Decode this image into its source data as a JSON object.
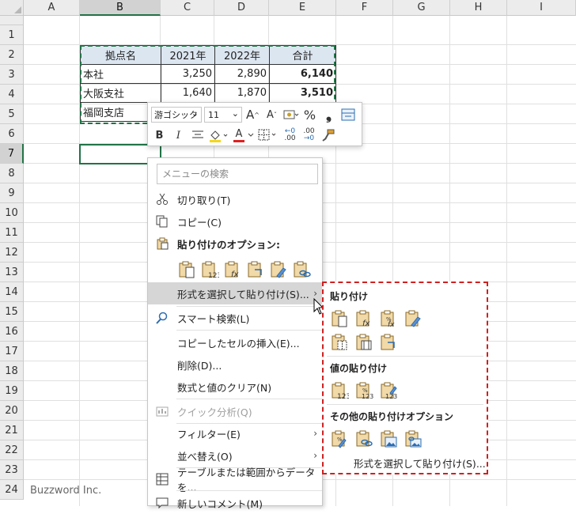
{
  "columns": [
    "A",
    "B",
    "C",
    "D",
    "E",
    "F",
    "G",
    "H",
    "I"
  ],
  "rows": [
    "1",
    "2",
    "3",
    "4",
    "5",
    "6",
    "7",
    "8",
    "9",
    "10",
    "11",
    "12",
    "13",
    "14",
    "15",
    "16",
    "17",
    "18",
    "19",
    "20",
    "21",
    "22",
    "23",
    "24"
  ],
  "table": {
    "headers": [
      "拠点名",
      "2021年",
      "2022年",
      "合計"
    ],
    "rows": [
      [
        "本社",
        "3,250",
        "2,890",
        "6,140"
      ],
      [
        "大阪支社",
        "1,640",
        "1,870",
        "3,510"
      ],
      [
        "福岡支店",
        "",
        "",
        ""
      ]
    ]
  },
  "mini_toolbar": {
    "font_name": "游ゴシック",
    "font_size": "11",
    "grow_label": "A",
    "shrink_label": "A",
    "percent_label": "%",
    "comma_label": "❟",
    "bold_label": "B",
    "italic_label": "I",
    "font_color_label": "A",
    "dec_inc_label": ".00",
    "dec_dec_label": ".00"
  },
  "context_menu": {
    "search_placeholder": "メニューの検索",
    "items": {
      "cut": "切り取り(T)",
      "copy": "コピー(C)",
      "paste_options": "貼り付けのオプション:",
      "paste_special": "形式を選択して貼り付け(S)...",
      "smart_lookup": "スマート検索(L)",
      "insert_copied": "コピーしたセルの挿入(E)...",
      "delete": "削除(D)...",
      "clear": "数式と値のクリア(N)",
      "quick_analysis": "クイック分析(Q)",
      "filter": "フィルター(E)",
      "sort": "並べ替え(O)",
      "table_range": "テーブルまたは範囲からデータを...",
      "new_comment": "新しいコメント(M)"
    }
  },
  "paste_submenu": {
    "section_paste": "貼り付け",
    "section_values": "値の貼り付け",
    "section_other": "その他の貼り付けオプション",
    "footer": "形式を選択して貼り付け(S)..."
  },
  "watermark": "Buzzword Inc.",
  "colors": {
    "excel_green": "#217346",
    "highlight_red": "#d02020",
    "header_fill": "#dce6f1"
  }
}
